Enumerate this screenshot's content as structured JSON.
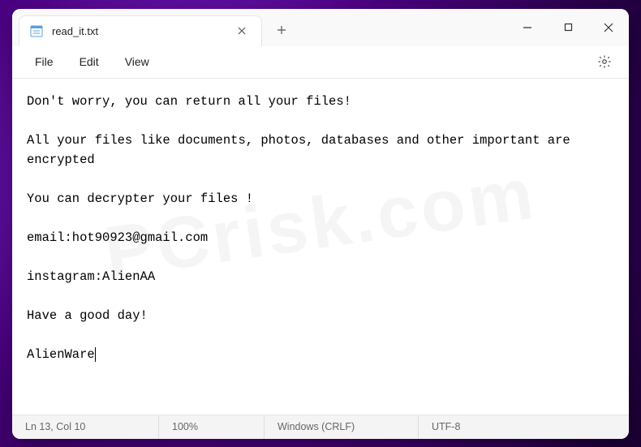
{
  "tab": {
    "title": "read_it.txt"
  },
  "menu": {
    "file": "File",
    "edit": "Edit",
    "view": "View"
  },
  "content": {
    "text": "Don't worry, you can return all your files!\n\nAll your files like documents, photos, databases and other important are encrypted\n\nYou can decrypter your files !\n\nemail:hot90923@gmail.com\n\ninstagram:AlienAA\n\nHave a good day!\n\nAlienWare"
  },
  "status": {
    "position": "Ln 13, Col 10",
    "zoom": "100%",
    "eol": "Windows (CRLF)",
    "encoding": "UTF-8"
  }
}
